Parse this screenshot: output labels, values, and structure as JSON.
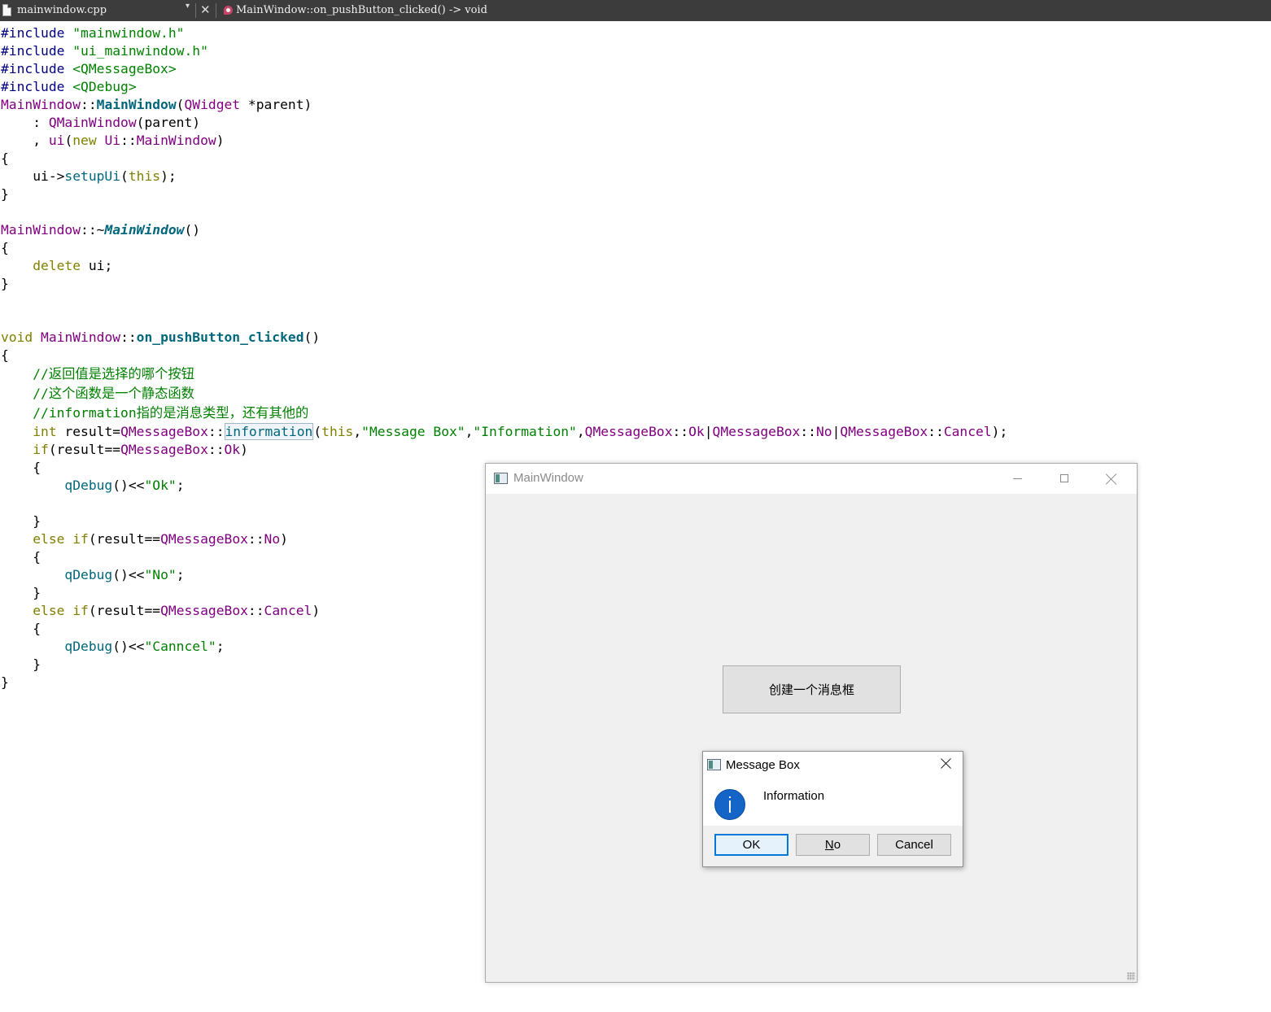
{
  "editor_bar": {
    "file_name": "mainwindow.cpp",
    "dropdown_glyph": "▾",
    "close_glyph": "✕",
    "current_symbol": "MainWindow::on_pushButton_clicked() -> void"
  },
  "code": {
    "l1": [
      "#include",
      "\"mainwindow.h\""
    ],
    "l2": [
      "#include",
      "\"ui_mainwindow.h\""
    ],
    "l3": [
      "#include",
      "<QMessageBox>"
    ],
    "l4": [
      "#include",
      "<QDebug>"
    ],
    "l5": [
      "MainWindow",
      "::",
      "MainWindow",
      "(",
      "QWidget",
      " *parent)"
    ],
    "l6": [
      "    : ",
      "QMainWindow",
      "(parent)"
    ],
    "l7": [
      "    , ",
      "ui",
      "(",
      "new",
      " ",
      "Ui",
      "::",
      "MainWindow",
      ")"
    ],
    "l8": "{",
    "l9": [
      "    ui->",
      "setupUi",
      "(",
      "this",
      ");"
    ],
    "l10": "}",
    "l12": [
      "MainWindow",
      "::~",
      "MainWindow",
      "()"
    ],
    "l13": "{",
    "l14": [
      "    ",
      "delete",
      " ui;"
    ],
    "l15": "}",
    "l18": [
      "void",
      " ",
      "MainWindow",
      "::",
      "on_pushButton_clicked",
      "()"
    ],
    "l19": "{",
    "l20": "    //返回值是选择的哪个按钮",
    "l21": "    //这个函数是一个静态函数",
    "l22": "    //information指的是消息类型，还有其他的",
    "l23": [
      "    ",
      "int",
      " result=",
      "QMessageBox",
      "::",
      "information",
      "(",
      "this",
      ",",
      "\"Message Box\"",
      ",",
      "\"Information\"",
      ",",
      "QMessageBox",
      "::",
      "Ok",
      "|",
      "QMessageBox",
      "::",
      "No",
      "|",
      "QMessageBox",
      "::",
      "Cancel",
      ");"
    ],
    "l24": [
      "    ",
      "if",
      "(result==",
      "QMessageBox",
      "::",
      "Ok",
      ")"
    ],
    "l25": "    {",
    "l26": [
      "        ",
      "qDebug",
      "()<<",
      "\"Ok\"",
      ";"
    ],
    "l28": "    }",
    "l29": [
      "    ",
      "else",
      " ",
      "if",
      "(result==",
      "QMessageBox",
      "::",
      "No",
      ")"
    ],
    "l30": "    {",
    "l31": [
      "        ",
      "qDebug",
      "()<<",
      "\"No\"",
      ";"
    ],
    "l32": "    }",
    "l33": [
      "    ",
      "else",
      " ",
      "if",
      "(result==",
      "QMessageBox",
      "::",
      "Cancel",
      ")"
    ],
    "l34": "    {",
    "l35": [
      "        ",
      "qDebug",
      "()<<",
      "\"Canncel\"",
      ";"
    ],
    "l36": "    }",
    "l37": "}"
  },
  "main_window": {
    "title": "MainWindow",
    "push_button_label": "创建一个消息框"
  },
  "message_box": {
    "title": "Message Box",
    "text": "Information",
    "icon": "information-icon",
    "buttons": {
      "ok": "OK",
      "no_mnemonic": "N",
      "no_rest": "o",
      "cancel": "Cancel"
    },
    "default_button_color": "#0078d7"
  },
  "colors": {
    "preprocessor": "#000080",
    "string": "#008000",
    "keyword": "#808000",
    "type": "#800080",
    "function": "#00677c",
    "comment": "#008000"
  }
}
